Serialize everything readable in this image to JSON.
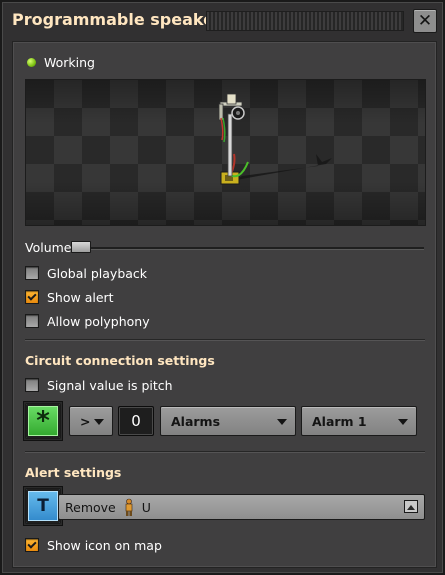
{
  "window": {
    "title": "Programmable speaker",
    "close_glyph": "✕"
  },
  "status": {
    "label": "Working",
    "color": "#7cc012"
  },
  "volume": {
    "label": "Volume",
    "level": 0.0
  },
  "options": [
    {
      "label": "Global playback",
      "checked": false
    },
    {
      "label": "Show alert",
      "checked": true
    },
    {
      "label": "Allow polyphony",
      "checked": false
    }
  ],
  "circuit": {
    "section_title": "Circuit connection settings",
    "signal_pitch_label": "Signal value is pitch",
    "signal_pitch_checked": false,
    "signal_slot_glyph": "*",
    "comparator": ">",
    "constant": "0",
    "instrument": "Alarms",
    "note": "Alarm 1"
  },
  "alert": {
    "section_title": "Alert settings",
    "icon_glyph": "T",
    "message_prefix": "Remove",
    "message_suffix": "U",
    "show_icon_label": "Show icon on map",
    "show_icon_checked": true
  },
  "colors": {
    "accent_heading": "#ffe6c0",
    "checkbox_checked": "#ffb733",
    "slot_green": "#2ea52a",
    "slot_blue": "#2f86c9"
  }
}
